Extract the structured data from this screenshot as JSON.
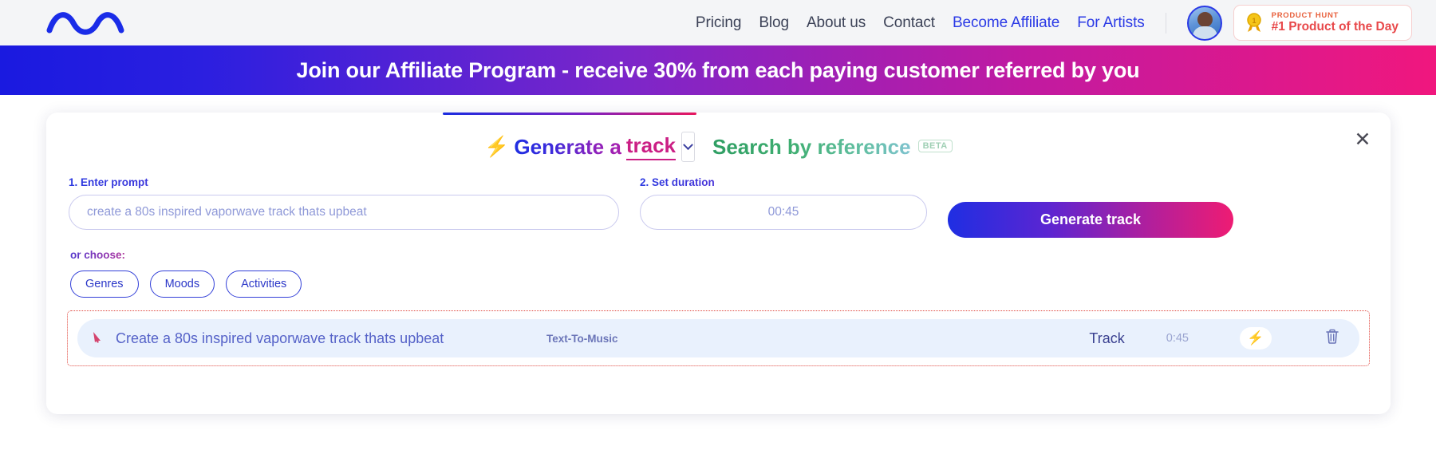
{
  "header": {
    "logo_icon": "wave-logo-icon",
    "nav": [
      {
        "label": "Pricing",
        "accent": false
      },
      {
        "label": "Blog",
        "accent": false
      },
      {
        "label": "About us",
        "accent": false
      },
      {
        "label": "Contact",
        "accent": false
      },
      {
        "label": "Become Affiliate",
        "accent": true
      },
      {
        "label": "For Artists",
        "accent": true
      }
    ],
    "avatar_icon": "user-avatar",
    "product_hunt": {
      "medal_icon": "medal-icon",
      "top_label": "PRODUCT HUNT",
      "main_label": "#1 Product of the Day"
    }
  },
  "banner": {
    "text": "Join our Affiliate Program - receive 30% from each paying customer referred by you"
  },
  "modal": {
    "close_label": "✕",
    "tabs": {
      "generate": {
        "bolt_icon": "⚡",
        "prefix": "Generate a ",
        "selected_type": "track",
        "chevron_icon": "chevron-down-icon"
      },
      "search": {
        "label": "Search by reference",
        "badge": "BETA"
      }
    },
    "prompt": {
      "label": "1. Enter prompt",
      "value": "",
      "placeholder": "create a 80s inspired vaporwave track thats upbeat"
    },
    "duration": {
      "label": "2. Set duration",
      "value": "00:45",
      "placeholder": "00:45"
    },
    "generate_button": "Generate track",
    "or_choose_label": "or choose:",
    "chips": [
      "Genres",
      "Moods",
      "Activities"
    ],
    "history": [
      {
        "cursor_icon": "cursor-arrow-icon",
        "prompt": "Create a 80s inspired vaporwave track thats upbeat",
        "type": "Text-To-Music",
        "kind": "Track",
        "duration": "0:45",
        "play_icon": "⚡",
        "delete_icon": "trash-icon"
      }
    ]
  },
  "colors": {
    "brand_blue": "#2b3ae6",
    "brand_magenta": "#ee1c73",
    "banner_start": "#1a1ae0",
    "banner_end": "#f0177e",
    "history_border": "#e0473f",
    "header_bg": "#f4f5f7"
  }
}
